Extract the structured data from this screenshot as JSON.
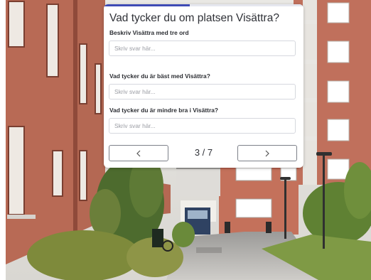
{
  "colors": {
    "accent": "#3e4bb5",
    "card_bg": "#ffffff",
    "text": "#2f3137",
    "placeholder": "#9a9ca3",
    "input_border": "#d6d8de"
  },
  "survey": {
    "title": "Vad tycker du om platsen Visättra?",
    "progress": {
      "current": 3,
      "total": 7,
      "fraction": 0.43
    },
    "questions": [
      {
        "label": "Beskriv Visättra med tre ord",
        "placeholder": "Skriv svar här..."
      },
      {
        "label": "Vad tycker du är bäst med Visättra?",
        "placeholder": "Skriv svar här..."
      },
      {
        "label": "Vad tycker du är mindre bra i Visättra?",
        "placeholder": "Skriv svar här..."
      }
    ],
    "navigation": {
      "page_indicator": "3 / 7",
      "prev_icon": "chevron-left-icon",
      "next_icon": "chevron-right-icon"
    }
  },
  "background": {
    "description_icon": "street-photo"
  }
}
